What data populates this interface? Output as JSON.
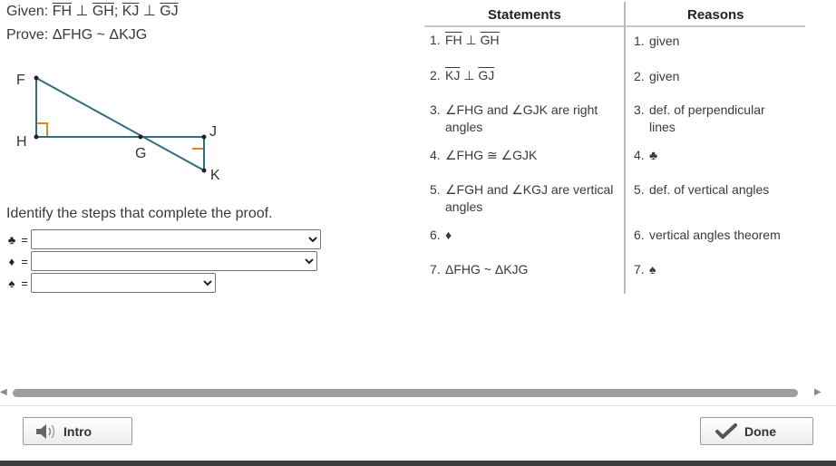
{
  "given": {
    "prefix": "Given: ",
    "seg1": "FH",
    "perp1": " ⊥ ",
    "seg2": "GH",
    "sep": "; ",
    "seg3": "KJ",
    "perp2": " ⊥ ",
    "seg4": "GJ"
  },
  "prove": "Prove: ΔFHG ~ ΔKJG",
  "figure": {
    "labels": {
      "F": "F",
      "H": "H",
      "G": "G",
      "J": "J",
      "K": "K"
    },
    "line_color": "#2e6e80",
    "right_angle_color": "#e08a1e"
  },
  "identify": "Identify the steps that complete the proof.",
  "answers": [
    {
      "symbol": "♣",
      "eq": "=",
      "value": ""
    },
    {
      "symbol": "♦",
      "eq": "=",
      "value": ""
    },
    {
      "symbol": "♠",
      "eq": "=",
      "value": ""
    }
  ],
  "table": {
    "headers": {
      "statements": "Statements",
      "reasons": "Reasons"
    },
    "rows": [
      {
        "num": "1.",
        "statement": {
          "seg1": "FH",
          "perp": " ⊥ ",
          "seg2": "GH"
        },
        "reason": [
          "given"
        ]
      },
      {
        "num": "2.",
        "statement": {
          "seg1": "KJ",
          "perp": " ⊥ ",
          "seg2": "GJ"
        },
        "reason": [
          "given"
        ]
      },
      {
        "num": "3.",
        "statement_lines": [
          "∠FHG and ∠GJK are right",
          "angles"
        ],
        "reason": [
          "def. of perpendicular",
          "lines"
        ]
      },
      {
        "num": "4.",
        "statement_lines": [
          "∠FHG ≅ ∠GJK"
        ],
        "reason": [
          "♣"
        ]
      },
      {
        "num": "5.",
        "statement_lines": [
          "∠FGH and ∠KGJ are vertical",
          "angles"
        ],
        "reason": [
          "def. of vertical angles"
        ]
      },
      {
        "num": "6.",
        "statement_lines": [
          "♦"
        ],
        "reason": [
          "vertical angles theorem"
        ]
      },
      {
        "num": "7.",
        "statement_lines": [
          "ΔFHG ~ ΔKJG"
        ],
        "reason": [
          "♠"
        ]
      }
    ]
  },
  "buttons": {
    "intro": "Intro",
    "done": "Done"
  },
  "colors": {
    "check": "#4a4a4a",
    "scrollbar": "#9e9e9e"
  }
}
